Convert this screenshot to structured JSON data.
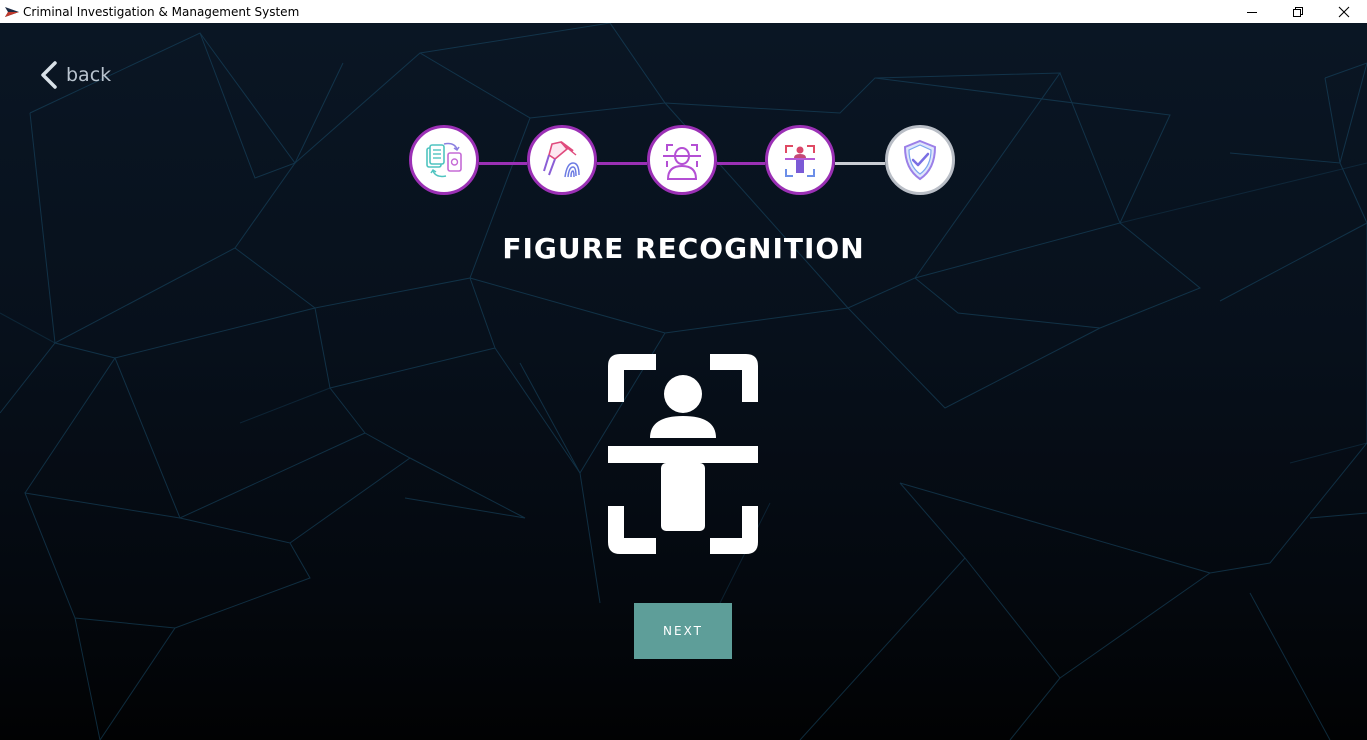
{
  "window": {
    "title": "Criminal Investigation & Management System",
    "icon": "app-logo-icon",
    "controls": [
      "minimize-icon",
      "restore-icon",
      "close-icon"
    ]
  },
  "nav": {
    "back_label": "back",
    "back_icon": "chevron-left-icon"
  },
  "stepper": {
    "accent_color": "#9b30b5",
    "pending_color": "#b9bec6",
    "steps": [
      {
        "icon": "documents-sync-icon",
        "state": "done"
      },
      {
        "icon": "fingerprint-dusting-icon",
        "state": "done"
      },
      {
        "icon": "face-scan-icon",
        "state": "done"
      },
      {
        "icon": "figure-scan-icon",
        "state": "current"
      },
      {
        "icon": "shield-check-icon",
        "state": "pending"
      }
    ]
  },
  "page": {
    "title": "FIGURE RECOGNITION",
    "hero_icon": "figure-recognition-icon"
  },
  "actions": {
    "next_label": "NEXT",
    "next_color": "#5e9e99"
  }
}
